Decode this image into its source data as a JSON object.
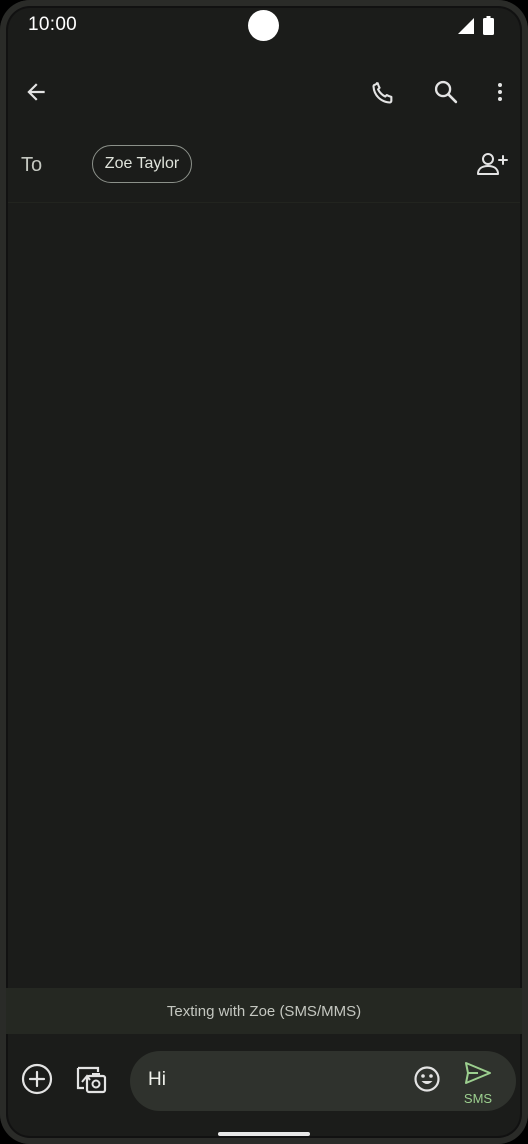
{
  "status_bar": {
    "time": "10:00"
  },
  "app_bar": {
    "icons": [
      "back-arrow-icon",
      "phone-icon",
      "search-icon",
      "more-vert-icon"
    ]
  },
  "recipients": {
    "to_label": "To",
    "chip_name": "Zoe Taylor"
  },
  "banner": {
    "text": "Texting with Zoe (SMS/MMS)"
  },
  "compose": {
    "message_value": "Hi",
    "send_label": "SMS"
  },
  "colors": {
    "background": "#1b1c1a",
    "banner": "#252822",
    "compose_field": "#2f322d",
    "accent": "#9ccf8f"
  }
}
